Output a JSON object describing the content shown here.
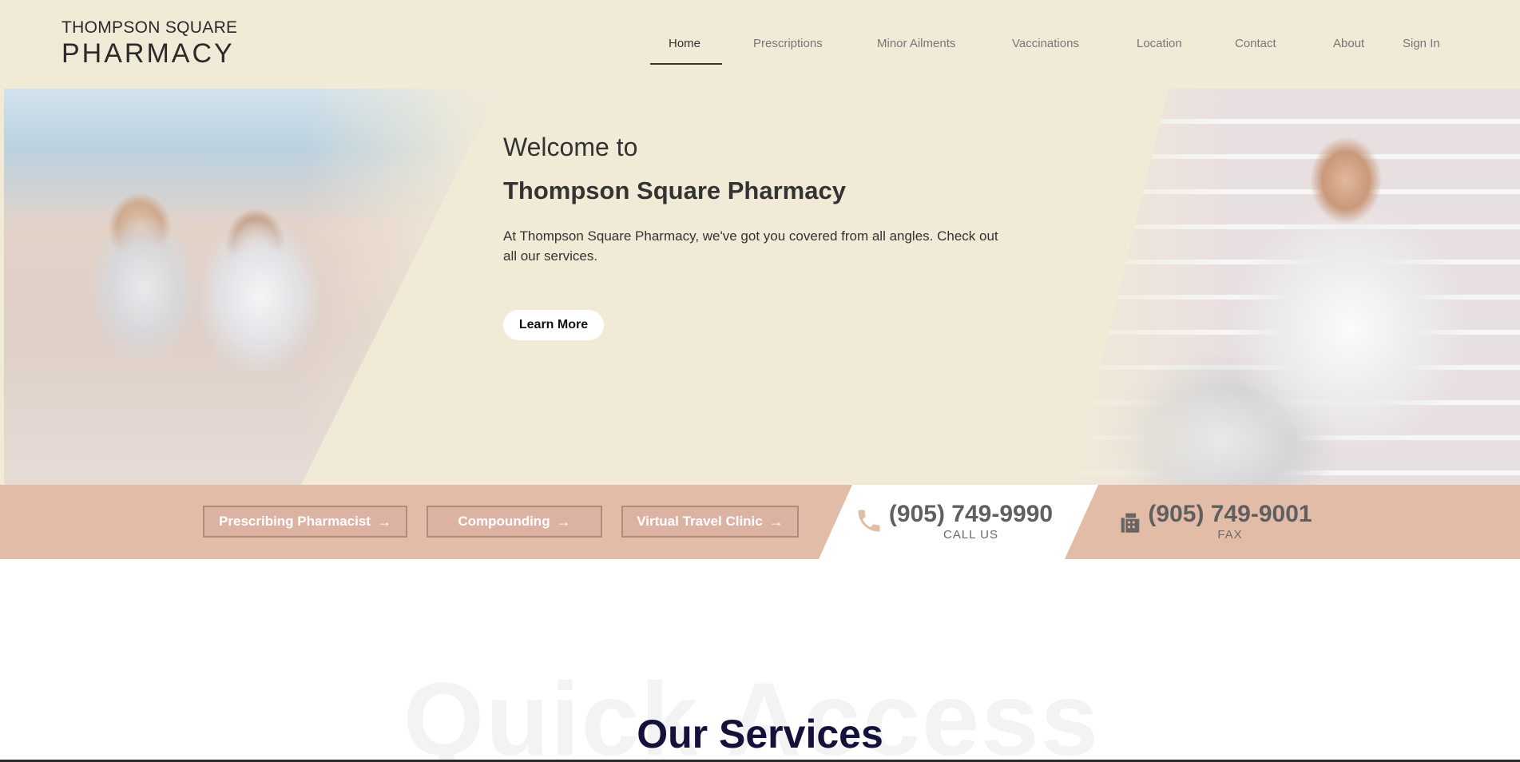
{
  "logo": {
    "line1": "THOMPSON SQUARE",
    "line2": "PHARMACY"
  },
  "nav": {
    "items": [
      {
        "label": "Home",
        "active": true
      },
      {
        "label": "Prescriptions"
      },
      {
        "label": "Minor Ailments"
      },
      {
        "label": "Vaccinations"
      },
      {
        "label": "Location"
      },
      {
        "label": "Contact"
      },
      {
        "label": "About"
      },
      {
        "label": "Sign In"
      }
    ]
  },
  "hero": {
    "welcome": "Welcome to",
    "title": "Thompson Square Pharmacy",
    "text": "At Thompson Square Pharmacy, we've got you covered from all angles. Check out all our services.",
    "button": "Learn More"
  },
  "quick": {
    "buttons": [
      {
        "label": "Prescribing Pharmacist",
        "arrow": "→"
      },
      {
        "label": "Compounding",
        "arrow": "→"
      },
      {
        "label": "Virtual Travel Clinic",
        "arrow": "→"
      }
    ],
    "call": {
      "number": "(905) 749-9990",
      "label": "CALL US",
      "icon": "phone-icon"
    },
    "fax": {
      "number": "(905) 749-9001",
      "label": "FAX",
      "icon": "fax-icon"
    }
  },
  "services": {
    "background_text": "Quick Access",
    "title": "Our Services"
  },
  "colors": {
    "header_bg": "#f1ead7",
    "quickbar_bg": "#e2bca7",
    "button_border": "#b48b7a",
    "title_navy": "#14123b"
  }
}
